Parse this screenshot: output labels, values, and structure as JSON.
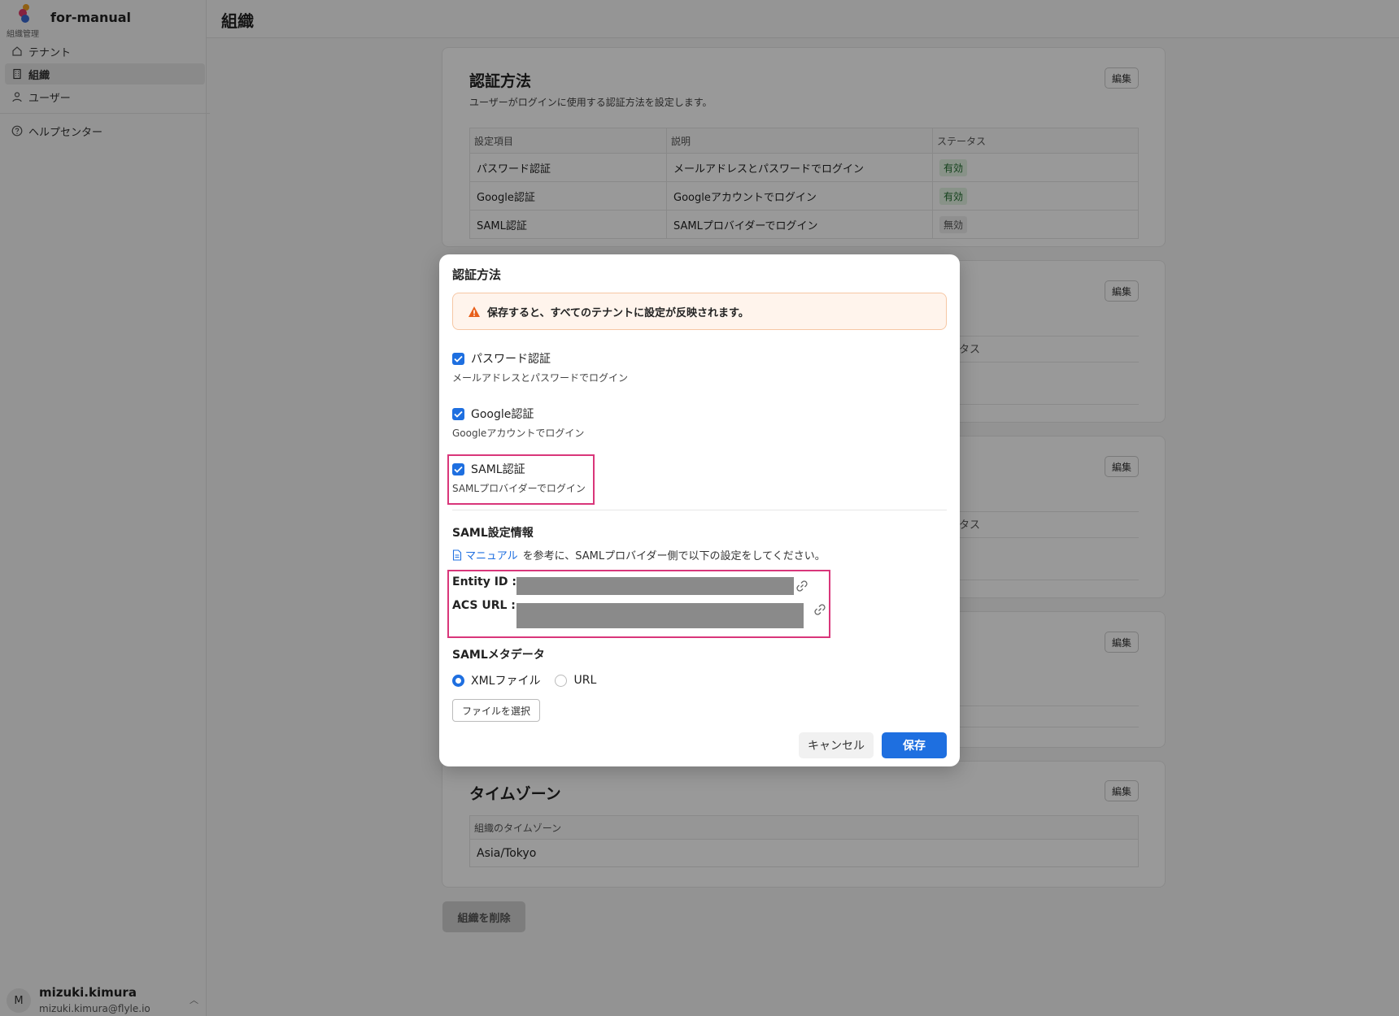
{
  "sidebar": {
    "org_name": "for-manual",
    "org_sub": "組織管理",
    "items": [
      {
        "label": "テナント",
        "icon": "home-icon",
        "active": false
      },
      {
        "label": "組織",
        "icon": "building-icon",
        "active": true
      },
      {
        "label": "ユーザー",
        "icon": "user-icon",
        "active": false
      }
    ],
    "help": {
      "label": "ヘルプセンター",
      "icon": "question-circle-icon"
    },
    "user": {
      "initial": "M",
      "name": "mizuki.kimura",
      "email": "mizuki.kimura@flyle.io"
    }
  },
  "header": {
    "title": "組織"
  },
  "auth_card": {
    "title": "認証方法",
    "description": "ユーザーがログインに使用する認証方法を設定します。",
    "edit_label": "編集",
    "columns": [
      "設定項目",
      "説明",
      "ステータス"
    ],
    "rows": [
      {
        "item": "パスワード認証",
        "desc": "メールアドレスとパスワードでログイン",
        "status": "有効"
      },
      {
        "item": "Google認証",
        "desc": "Googleアカウントでログイン",
        "status": "有効"
      },
      {
        "item": "SAML認証",
        "desc": "SAMLプロバイダーでログイン",
        "status": "無効"
      }
    ]
  },
  "hidden_cards": {
    "edit_label": "編集",
    "partial_status": "タス"
  },
  "timezone_card": {
    "title": "タイムゾーン",
    "edit_label": "編集",
    "column": "組織のタイムゾーン",
    "value": "Asia/Tokyo"
  },
  "delete_button": "組織を削除",
  "modal": {
    "title": "認証方法",
    "warning": "保存すると、すべてのテナントに設定が反映されます。",
    "options": [
      {
        "label": "パスワード認証",
        "desc": "メールアドレスとパスワードでログイン",
        "checked": true
      },
      {
        "label": "Google認証",
        "desc": "Googleアカウントでログイン",
        "checked": true
      },
      {
        "label": "SAML認証",
        "desc": "SAMLプロバイダーでログイン",
        "checked": true
      }
    ],
    "saml_info": {
      "title": "SAML設定情報",
      "manual_link": "マニュアル",
      "manual_text": "を参考に、SAMLプロバイダー側で以下の設定をしてください。",
      "entity_id_label": "Entity ID :",
      "acs_url_label": "ACS URL :"
    },
    "metadata": {
      "title": "SAMLメタデータ",
      "option_xml": "XMLファイル",
      "option_url": "URL",
      "selected": "XMLファイル",
      "file_button": "ファイルを選択"
    },
    "cancel_label": "キャンセル",
    "save_label": "保存"
  },
  "colors": {
    "accent": "#1e6fe0",
    "highlight": "#d9367a",
    "warning_bg": "#fff4ec",
    "warning_icon": "#e8601c"
  }
}
